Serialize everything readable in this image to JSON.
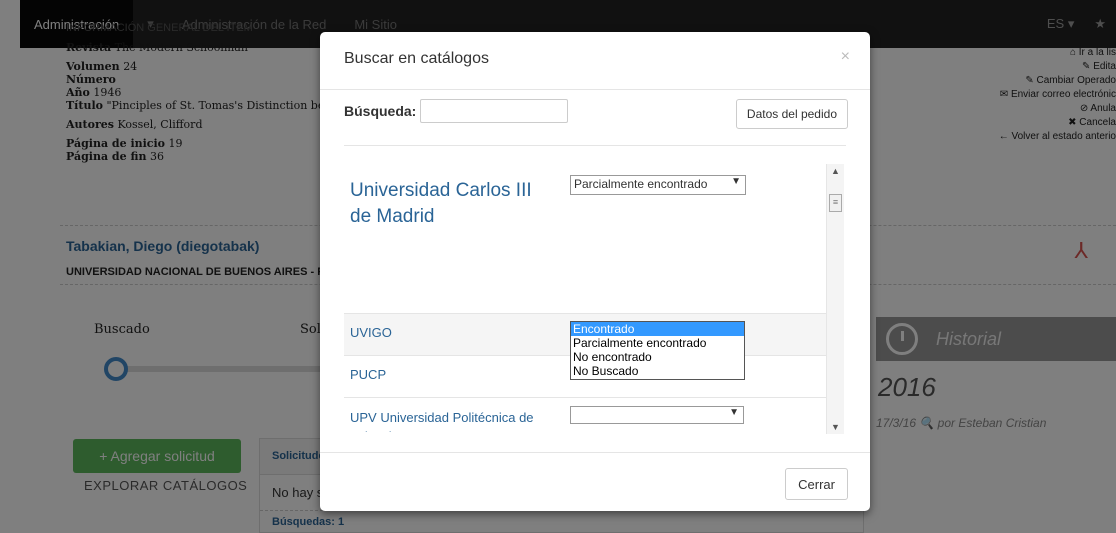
{
  "nav": {
    "items": [
      "Administración",
      "▾",
      "Administración de la Red",
      "Mi Sitio"
    ],
    "lang": "ES ▾",
    "star": "★"
  },
  "item_info": {
    "heading": "INFORMACIÓN GENERAL DEL ITEM",
    "revista_label": "Revista",
    "revista": "The Modern Schoolman",
    "volumen_label": "Volumen",
    "volumen": "24",
    "numero_label": "Número",
    "anio_label": "Año",
    "anio": "1946",
    "titulo_label": "Título",
    "titulo": "\"Pinciples of St. Tomas's Distinction betwee",
    "autores_label": "Autores",
    "autores": "Kossel, Clifford",
    "pag_inicio_label": "Página de inicio",
    "pag_inicio": "19",
    "pag_fin_label": "Página de fin",
    "pag_fin": "36"
  },
  "actions": [
    "Ir a la lis",
    "Edita",
    "Cambiar Operado",
    "Enviar correo electrónic",
    "Anula",
    "Cancela",
    "← Volver al estado anterio"
  ],
  "user": {
    "name": "Tabakian, Diego (diegotabak)",
    "org": "UNIVERSIDAD NACIONAL DE BUENOS AIRES - Fac"
  },
  "timeline": {
    "step1": "Buscado",
    "step2": "Soli"
  },
  "historial": {
    "title": "Historial",
    "year": "2016",
    "entry": "17/3/16 🔍 por Esteban Cristian"
  },
  "left_panel": {
    "add_button": "+ Agregar solicitud",
    "explore": "EXPLORAR CATÁLOGOS",
    "solicitudes": "Solicitude",
    "no_hay": "No hay s",
    "busquedas": "Búsquedas: 1"
  },
  "modal": {
    "title": "Buscar en catálogos",
    "close": "×",
    "search_label": "Búsqueda:",
    "search_value": "",
    "datos_button": "Datos del pedido",
    "cerrar_button": "Cerrar",
    "results": [
      {
        "name": "Universidad Carlos III de Madrid",
        "status": "Parcialmente encontrado"
      },
      {
        "name": "UVIGO",
        "status": ""
      },
      {
        "name": "PUCP",
        "status": ""
      },
      {
        "name": "UPV Universidad Politécnica de Valencia",
        "status": ""
      }
    ],
    "options": [
      "Encontrado",
      "Parcialmente encontrado",
      "No encontrado",
      "No Buscado"
    ],
    "highlighted_option": "Encontrado"
  },
  "colors": {
    "link": "#2a6496",
    "green": "#5cb85c",
    "highlight": "#3399ff",
    "nav": "#222222"
  }
}
